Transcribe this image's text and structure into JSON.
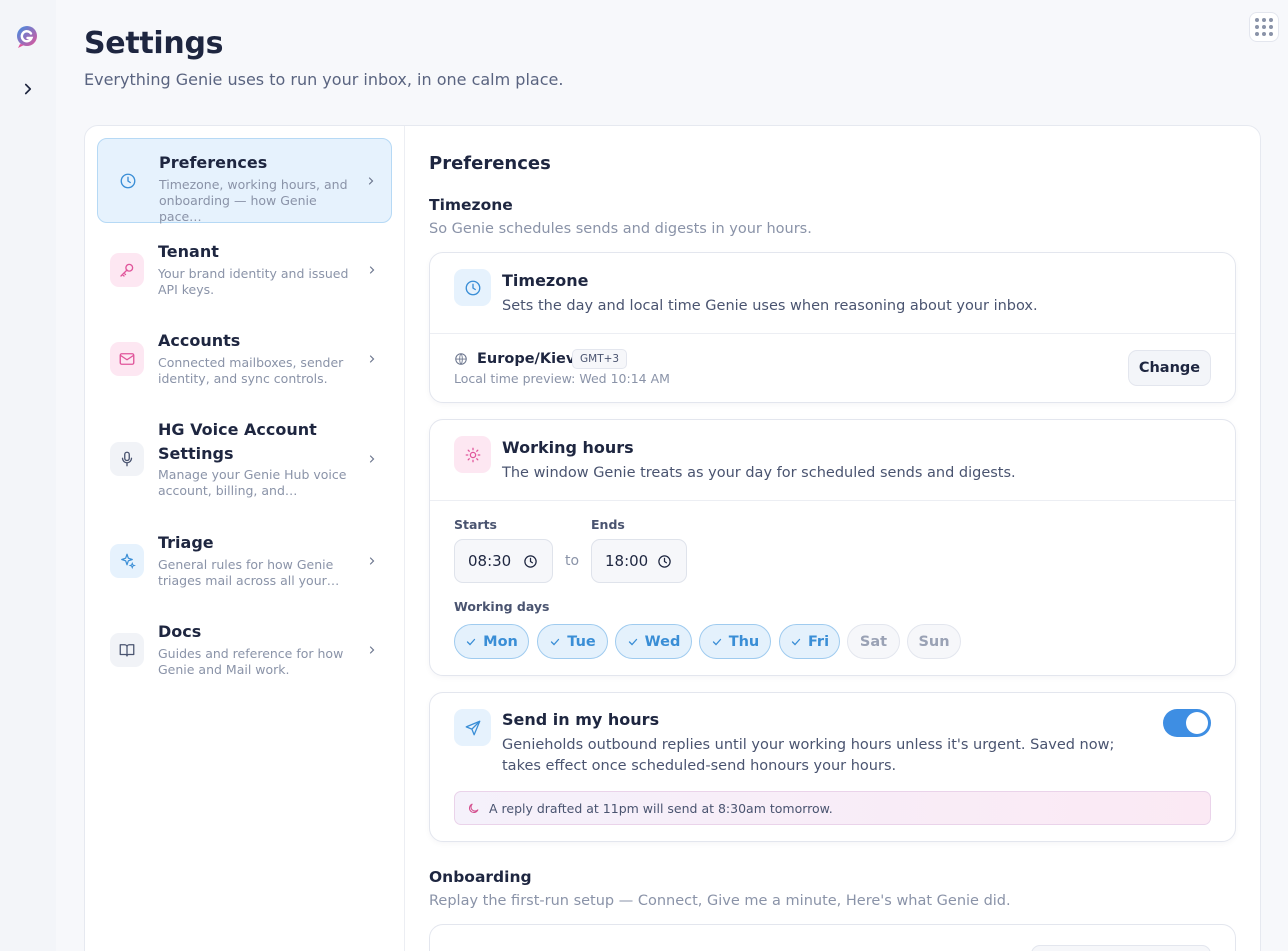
{
  "page": {
    "title": "Settings",
    "subtitle": "Everything Genie uses to run your inbox, in one calm place."
  },
  "nav": {
    "items": [
      {
        "label": "Preferences",
        "desc": "Timezone, working hours, and onboarding — how Genie pace…",
        "icon": "clock-icon",
        "active": true
      },
      {
        "label": "Tenant",
        "desc": "Your brand identity and issued API keys.",
        "icon": "key-icon"
      },
      {
        "label": "Accounts",
        "desc": "Connected mailboxes, sender identity, and sync controls.",
        "icon": "mail-icon"
      },
      {
        "label": "HG Voice Account Settings",
        "desc": "Manage your Genie Hub voice account, billing, and…",
        "icon": "mic-icon"
      },
      {
        "label": "Triage",
        "desc": "General rules for how Genie triages mail across all your…",
        "icon": "sparkles-icon"
      },
      {
        "label": "Docs",
        "desc": "Guides and reference for how Genie and Mail work.",
        "icon": "book-icon"
      }
    ]
  },
  "content": {
    "heading": "Preferences",
    "timezone_section": {
      "title": "Timezone",
      "subtitle": "So Genie schedules sends and digests in your hours."
    },
    "timezone_card": {
      "title": "Timezone",
      "desc": "Sets the day and local time Genie uses when reasoning about your inbox.",
      "zone": "Europe/Kiev",
      "offset": "GMT+3",
      "preview": "Local time preview: Wed 10:14 AM",
      "change_label": "Change"
    },
    "hours_card": {
      "title": "Working hours",
      "desc": "The window Genie treats as your day for scheduled sends and digests.",
      "starts_label": "Starts",
      "starts_value": "08:30",
      "ends_label": "Ends",
      "ends_value": "18:00",
      "to_label": "to",
      "days_label": "Working days",
      "days": [
        {
          "label": "Mon",
          "on": true
        },
        {
          "label": "Tue",
          "on": true
        },
        {
          "label": "Wed",
          "on": true
        },
        {
          "label": "Thu",
          "on": true
        },
        {
          "label": "Fri",
          "on": true
        },
        {
          "label": "Sat",
          "on": false
        },
        {
          "label": "Sun",
          "on": false
        }
      ]
    },
    "send_card": {
      "title": "Send in my hours",
      "desc": "Genieholds outbound replies until your working hours unless it's urgent. Saved now; takes effect once scheduled-send honours your hours.",
      "enabled": true,
      "note": "A reply drafted at 11pm will send at 8:30am tomorrow."
    },
    "onboarding_section": {
      "title": "Onboarding",
      "subtitle": "Replay the first-run setup — Connect, Give me a minute, Here's what Genie did."
    }
  },
  "colors": {
    "accent": "#3e8ee3",
    "active_bg": "#e6f2fd",
    "pink_icon_bg": "#fde7f2",
    "blue_icon_bg": "#e6f2fd"
  }
}
